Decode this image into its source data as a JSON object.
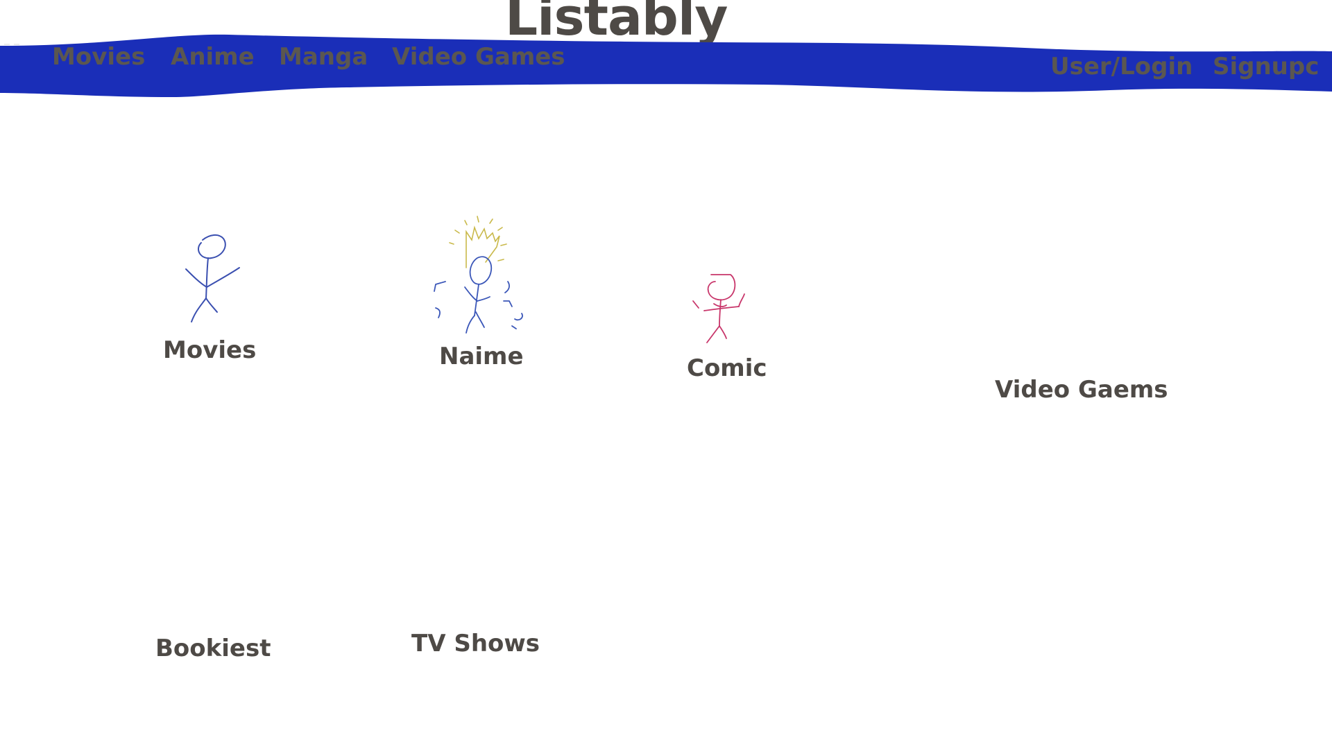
{
  "app": {
    "title": "Listably"
  },
  "nav": {
    "left_items": [
      "Movies",
      "Anime",
      "Manga",
      "Video Games"
    ],
    "right_items": [
      "User/Login",
      "Signupc"
    ],
    "band_color": "#1a2eb8"
  },
  "categories": [
    {
      "label": "Movies",
      "icon": "stick-figure-icon"
    },
    {
      "label": "Naime",
      "icon": "spiky-hair-stick-figure-icon"
    },
    {
      "label": "Comic",
      "icon": "red-stick-figure-icon"
    },
    {
      "label": "Video Gaems",
      "icon": ""
    },
    {
      "label": "Bookiest",
      "icon": ""
    },
    {
      "label": "TV Shows",
      "icon": ""
    }
  ],
  "colors": {
    "text": "#4e4a46",
    "movies_doodle": "#3a4fb0",
    "naime_hair": "#c9b94a",
    "naime_body": "#3a56b8",
    "comic_doodle": "#c8356a"
  }
}
